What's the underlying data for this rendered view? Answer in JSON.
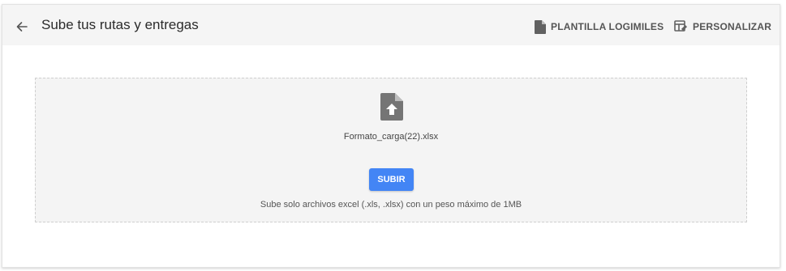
{
  "header": {
    "title": "Sube tus rutas y entregas",
    "back_icon": "arrow-left-icon",
    "template_button": {
      "label": "PLANTILLA LOGIMILES",
      "icon": "document-icon"
    },
    "customize_button": {
      "label": "PERSONALIZAR",
      "icon": "table-edit-icon"
    }
  },
  "upload": {
    "file_icon": "file-upload-icon",
    "file_name": "Formato_carga(22).xlsx",
    "button_label": "SUBIR",
    "hint": "Sube solo archivos excel (.xls, .xlsx) con un peso máximo de 1MB"
  },
  "colors": {
    "accent": "#4385f5",
    "header_bg": "#f5f5f5",
    "dropzone_bg": "#f4f4f4",
    "icon": "#616161"
  }
}
